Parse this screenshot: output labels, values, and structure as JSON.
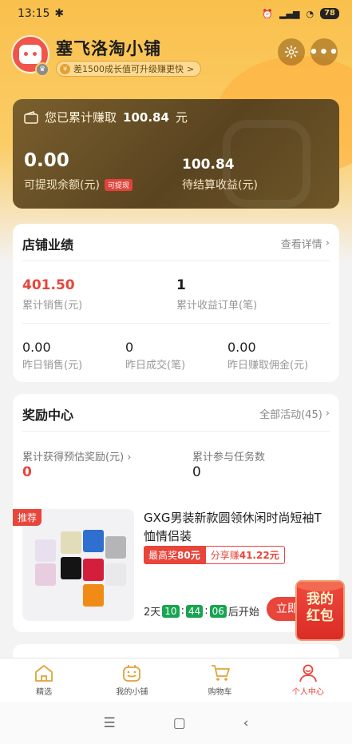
{
  "status_bar": {
    "time": "13:15",
    "battery": "78"
  },
  "header": {
    "shop_name": "塞飞洛淘小铺",
    "growth_tip": "差1500成长值可升级赚更快",
    "growth_chevron": ">"
  },
  "earnings": {
    "title_prefix": "您已累计赚取",
    "title_amount": "100.84",
    "title_unit": "元",
    "withdrawable_value": "0.00",
    "withdrawable_label": "可提现余额(元)",
    "withdraw_tag": "可提现",
    "pending_value": "100.84",
    "pending_label": "待结算收益(元)"
  },
  "performance": {
    "title": "店铺业绩",
    "link": "查看详情",
    "total_sales_value": "401.50",
    "total_sales_label": "累计销售(元)",
    "total_orders_value": "1",
    "total_orders_label": "累计收益订单(笔)",
    "yesterday": [
      {
        "value": "0.00",
        "label": "昨日销售(元)"
      },
      {
        "value": "0",
        "label": "昨日成交(笔)"
      },
      {
        "value": "0.00",
        "label": "昨日赚取佣金(元)"
      }
    ]
  },
  "rewards": {
    "title": "奖励中心",
    "link": "全部活动(45)",
    "est_reward_label": "累计获得预估奖励(元)",
    "est_reward_value": "0",
    "tasks_label": "累计参与任务数",
    "tasks_value": "0"
  },
  "product": {
    "badge": "推荐",
    "title": "GXG男装新款圆领休闲时尚短袖T恤情侣装",
    "max_reward_label": "最高奖",
    "max_reward_value": "80元",
    "share_label": "分享赚",
    "share_value": "41.22元",
    "countdown_days": "2天",
    "countdown_h": "10",
    "countdown_m": "44",
    "countdown_s": "06",
    "countdown_suffix": "后开始",
    "button": "立即"
  },
  "red_packet": {
    "line1": "我的",
    "line2": "红包"
  },
  "tabs": [
    {
      "label": "精选"
    },
    {
      "label": "我的小铺"
    },
    {
      "label": "购物车"
    },
    {
      "label": "个人中心"
    }
  ],
  "colors": {
    "accent": "#e8453b",
    "brand_yellow": "#f9c04c",
    "earn_card": "#6b5226",
    "timer_green": "#18a450"
  }
}
